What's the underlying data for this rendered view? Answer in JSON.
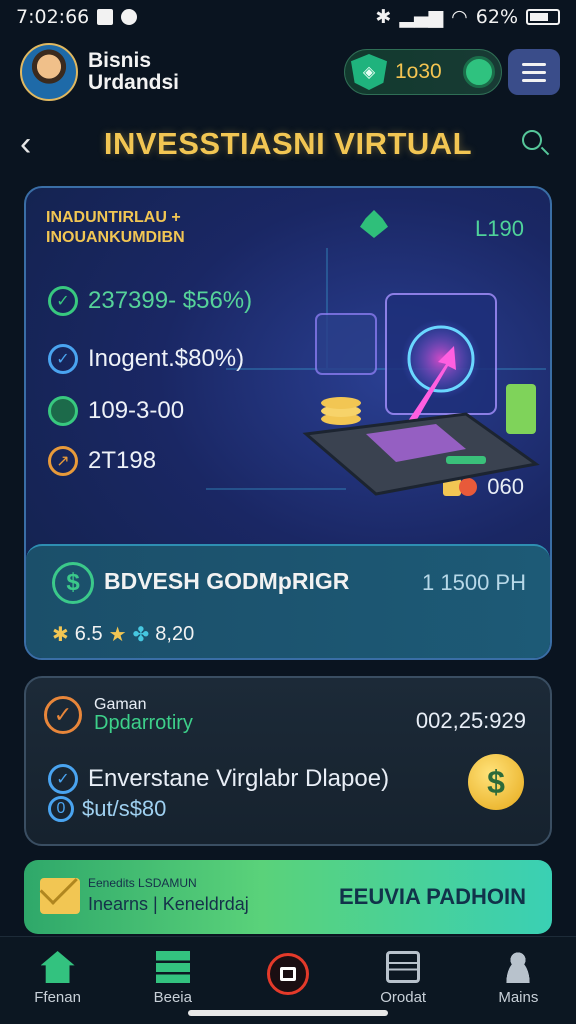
{
  "status_bar": {
    "time": "7:02:66",
    "battery": "62%"
  },
  "header": {
    "user_name_line1": "Bisnis",
    "user_name_line2": "Urdandsi",
    "coin_value": "1o30"
  },
  "title_bar": {
    "title": "INVESSTIASNI VIRTUAL"
  },
  "main_card": {
    "heading_line1": "INADUNTIRLAU +",
    "heading_line2": "INOUANKUMDIBN",
    "top_value": "L190",
    "stats": [
      {
        "icon": "check-icon",
        "text": "237399- $56%)"
      },
      {
        "icon": "check-icon",
        "text": "Inogent.$80%)"
      },
      {
        "icon": "globe-icon",
        "text": "109-3-00"
      },
      {
        "icon": "chart-icon",
        "text": "2T198"
      }
    ],
    "badge_value": "060",
    "project": {
      "name": "BDVESH GODMpRIGR",
      "price": "1 1500 PH",
      "meta_a": "6.5",
      "meta_b": "8,20"
    }
  },
  "opportunity_card": {
    "label": "Gaman",
    "sublabel": "Dpdarrotiry",
    "value": "002,25:929",
    "row1_text": "Enverstane Virglabr Dlapoe)",
    "row2_text": "$ut/s$80",
    "coin_symbol": "$"
  },
  "banner": {
    "small_text": "Eenedits LSDAMUN",
    "line2_text": "Inearns | Keneldrdaj",
    "cta": "EEUVIA PADHOIN"
  },
  "bottom_nav": {
    "items": [
      {
        "label": "Ffenan"
      },
      {
        "label": "Beeia"
      },
      {
        "label": ""
      },
      {
        "label": "Orodat"
      },
      {
        "label": "Mains"
      }
    ]
  },
  "colors": {
    "accent_gold": "#f2c653",
    "accent_green": "#38c87f",
    "background": "#0a1420"
  }
}
